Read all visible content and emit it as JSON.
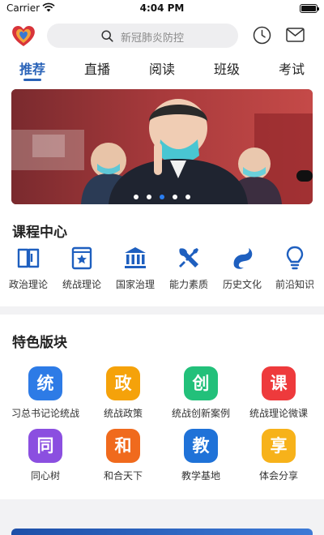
{
  "status_bar": {
    "carrier": "Carrier",
    "time": "4:04 PM"
  },
  "header": {
    "search_placeholder": "新冠肺炎防控",
    "icons": [
      "app-logo",
      "search-icon",
      "history-clock-icon",
      "mail-icon"
    ]
  },
  "tabs": [
    {
      "label": "推荐",
      "active": true
    },
    {
      "label": "直播",
      "active": false
    },
    {
      "label": "阅读",
      "active": false
    },
    {
      "label": "班级",
      "active": false
    },
    {
      "label": "考试",
      "active": false
    }
  ],
  "banner": {
    "slide_count": 5,
    "active_slide": 3
  },
  "course_center": {
    "title": "课程中心",
    "items": [
      {
        "label": "政治理论",
        "icon": "book-icon"
      },
      {
        "label": "统战理论",
        "icon": "star-book-icon"
      },
      {
        "label": "国家治理",
        "icon": "government-building-icon"
      },
      {
        "label": "能力素质",
        "icon": "tools-icon"
      },
      {
        "label": "历史文化",
        "icon": "dragon-icon"
      },
      {
        "label": "前沿知识",
        "icon": "lightbulb-icon"
      }
    ]
  },
  "featured": {
    "title": "特色版块",
    "items": [
      {
        "glyph": "统",
        "label": "习总书记论统战",
        "color": "#2d7be6"
      },
      {
        "glyph": "政",
        "label": "统战政策",
        "color": "#f5a20a"
      },
      {
        "glyph": "创",
        "label": "统战创新案例",
        "color": "#22c07a"
      },
      {
        "glyph": "课",
        "label": "统战理论微课",
        "color": "#ee3a3c"
      },
      {
        "glyph": "同",
        "label": "同心树",
        "color": "#8b4fe0"
      },
      {
        "glyph": "和",
        "label": "和合天下",
        "color": "#f06a1d"
      },
      {
        "glyph": "教",
        "label": "教学基地",
        "color": "#1f72d8"
      },
      {
        "glyph": "享",
        "label": "体会分享",
        "color": "#f7b21a"
      }
    ]
  },
  "colors": {
    "accent": "#2a63b8",
    "dot_active": "#2a7ef0",
    "icon_blue": "#1e5fbf"
  }
}
